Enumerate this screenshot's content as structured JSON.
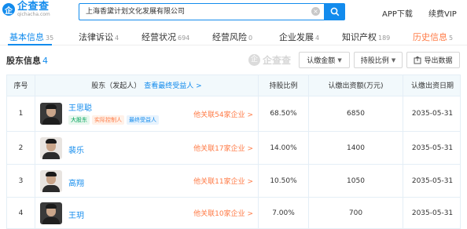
{
  "header": {
    "logo_cn": "企查查",
    "logo_en": "qichacha.com",
    "logo_mark": "企",
    "search_value": "上海香黛计划文化发展有限公司",
    "links": [
      "APP下载",
      "续费VIP"
    ]
  },
  "tabs": [
    {
      "label": "基本信息",
      "count": "35"
    },
    {
      "label": "法律诉讼",
      "count": "4"
    },
    {
      "label": "经营状况",
      "count": "694"
    },
    {
      "label": "经营风险",
      "count": "0"
    },
    {
      "label": "企业发展",
      "count": "4"
    },
    {
      "label": "知识产权",
      "count": "189"
    },
    {
      "label": "历史信息",
      "count": "5"
    }
  ],
  "section": {
    "title": "股东信息",
    "count": "4",
    "watermark": "企查查",
    "watermark_mark": "企",
    "buttons": {
      "amount": "认缴金额",
      "ratio": "持股比例",
      "export": "导出数据"
    }
  },
  "table": {
    "headers": [
      "序号",
      "股东（发起人）",
      "持股比例",
      "认缴出资额(万元)",
      "认缴出资日期"
    ],
    "beneficiary_link": "查看最终受益人 >",
    "rows": [
      {
        "index": "1",
        "name": "王思聪",
        "tags": [
          "大股东",
          "实际控制人",
          "最终受益人"
        ],
        "assoc": "他关联54家企业 >",
        "ratio": "68.50%",
        "amount": "6850",
        "date": "2035-05-31"
      },
      {
        "index": "2",
        "name": "裴乐",
        "tags": [],
        "assoc": "他关联17家企业 >",
        "ratio": "14.00%",
        "amount": "1400",
        "date": "2035-05-31"
      },
      {
        "index": "3",
        "name": "高翔",
        "tags": [],
        "assoc": "他关联11家企业 >",
        "ratio": "10.50%",
        "amount": "1050",
        "date": "2035-05-31"
      },
      {
        "index": "4",
        "name": "王玥",
        "tags": [],
        "assoc": "他关联10家企业 >",
        "ratio": "7.00%",
        "amount": "700",
        "date": "2035-05-31"
      }
    ]
  },
  "colors": {
    "accent": "#128bed",
    "orange": "#ff7a45",
    "green": "#00a35a"
  }
}
